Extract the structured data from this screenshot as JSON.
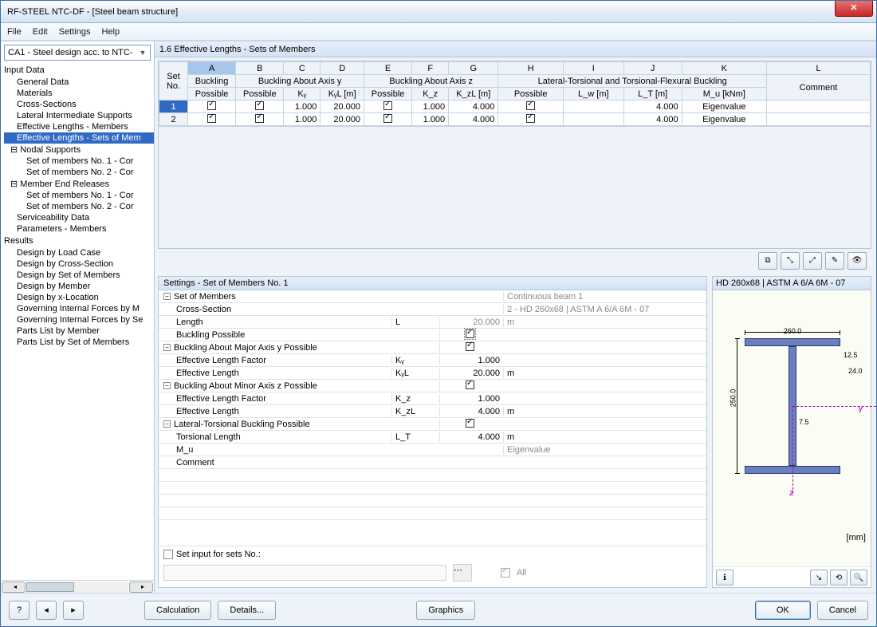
{
  "window": {
    "title": "RF-STEEL NTC-DF - [Steel beam structure]"
  },
  "menu": {
    "file": "File",
    "edit": "Edit",
    "settings": "Settings",
    "help": "Help"
  },
  "combo": {
    "text": "CA1 - Steel design acc. to NTC-"
  },
  "tree": {
    "input": "Input Data",
    "general": "General Data",
    "materials": "Materials",
    "cross": "Cross-Sections",
    "lateral": "Lateral Intermediate Supports",
    "eff_members": "Effective Lengths - Members",
    "eff_sets": "Effective Lengths - Sets of Mem",
    "nodal": "Nodal Supports",
    "ns1": "Set of members No. 1 - Cor",
    "ns2": "Set of members No. 2 - Cor",
    "mer": "Member End Releases",
    "mer1": "Set of members No. 1 - Cor",
    "mer2": "Set of members No. 2 - Cor",
    "serv": "Serviceability Data",
    "params": "Parameters - Members",
    "results": "Results",
    "r_lc": "Design by Load Case",
    "r_cs": "Design by Cross-Section",
    "r_som": "Design by Set of Members",
    "r_mem": "Design by Member",
    "r_xloc": "Design by x-Location",
    "r_gif_m": "Governing Internal Forces by M",
    "r_gif_s": "Governing Internal Forces by Se",
    "r_plm": "Parts List by Member",
    "r_plsom": "Parts List by Set of Members"
  },
  "pane_title": "1.6 Effective Lengths - Sets of Members",
  "grid": {
    "letters": [
      "A",
      "B",
      "C",
      "D",
      "E",
      "F",
      "G",
      "H",
      "I",
      "J",
      "K",
      "L"
    ],
    "group_set": "Set\nNo.",
    "group_buck": "Buckling\nPossible",
    "group_y": "Buckling About Axis y",
    "group_z": "Buckling About Axis z",
    "group_lt": "Lateral-Torsional and Torsional-Flexural Buckling",
    "h_possible": "Possible",
    "h_ky": "Kᵧ",
    "h_kyl": "KᵧL [m]",
    "h_kz": "K_z",
    "h_kzl": "K_zL [m]",
    "h_lw": "L_w [m]",
    "h_lt": "L_T [m]",
    "h_mu": "M_u [kNm]",
    "h_comment": "Comment",
    "rows": [
      {
        "no": "1",
        "ky": "1.000",
        "kyl": "20.000",
        "kz": "1.000",
        "kzl": "4.000",
        "lt": "4.000",
        "mu": "Eigenvalue"
      },
      {
        "no": "2",
        "ky": "1.000",
        "kyl": "20.000",
        "kz": "1.000",
        "kzl": "4.000",
        "lt": "4.000",
        "mu": "Eigenvalue"
      }
    ]
  },
  "settings": {
    "header": "Settings - Set of Members No. 1",
    "set_of_members": "Set of Members",
    "set_of_members_val": "Continuous beam 1",
    "cross_section": "Cross-Section",
    "cross_section_val": "2 - HD 260x68 | ASTM A 6/A 6M - 07",
    "length": "Length",
    "length_val": "20.000",
    "length_unit": "m",
    "buckling_possible": "Buckling Possible",
    "maj_y": "Buckling About Major Axis y Possible",
    "elf": "Effective Length Factor",
    "ky_sym": "Kᵧ",
    "ky_val": "1.000",
    "el": "Effective Length",
    "kyl_sym": "KᵧL",
    "kyl_val": "20.000",
    "min_z": "Buckling About Minor Axis z Possible",
    "kz_sym": "K_z",
    "kz_val": "1.000",
    "kzl_sym": "K_zL",
    "kzl_val": "4.000",
    "ltb": "Lateral-Torsional Buckling Possible",
    "tors_len": "Torsional Length",
    "lt_sym": "L_T",
    "lt_val": "4.000",
    "mu": "M_u",
    "mu_val": "Eigenvalue",
    "comment": "Comment",
    "footer_cb": "Set input for sets No.:",
    "footer_all": "All"
  },
  "preview": {
    "header": "HD 260x68 | ASTM A 6/A 6M - 07",
    "dim_w": "260.0",
    "dim_h": "250.0",
    "dim_t1": "12.5",
    "dim_t2": "24.0",
    "dim_tw": "7.5",
    "axis_y": "y",
    "axis_z": "z",
    "unit": "[mm]"
  },
  "footer": {
    "calc": "Calculation",
    "details": "Details...",
    "graphics": "Graphics",
    "ok": "OK",
    "cancel": "Cancel"
  }
}
